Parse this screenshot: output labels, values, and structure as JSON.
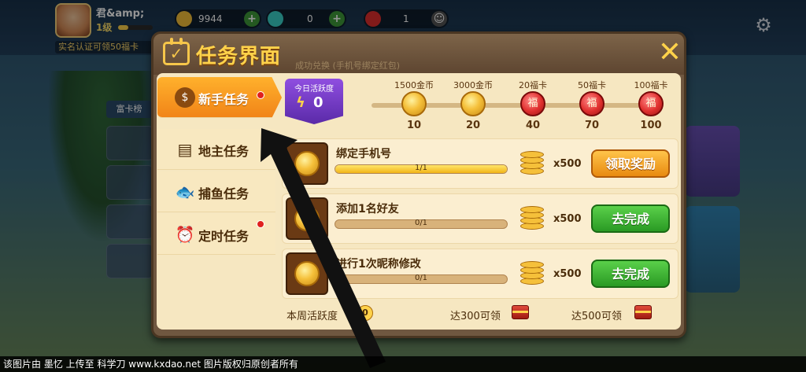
{
  "background": {
    "player_name": "君&amp;",
    "player_level": "1级",
    "realname_tip": "实名认证可领50福卡",
    "resources": [
      {
        "name": "gold-coin",
        "value": "9944",
        "color": "#f5c03a"
      },
      {
        "name": "diamond",
        "value": "0",
        "color": "#3ad0c8"
      },
      {
        "name": "lucky-card",
        "value": "1",
        "color": "#e0302e"
      }
    ],
    "rank_label": "富卡榜",
    "faded_header": "成功兑换 (手机号绑定红包)"
  },
  "modal": {
    "title": "任务界面",
    "close": "✕"
  },
  "tabs": [
    {
      "label": "新手任务",
      "icon": "money-bag-icon",
      "glyph": "$",
      "active": true,
      "dot": true
    },
    {
      "label": "地主任务",
      "icon": "calendar-icon",
      "glyph": "▤",
      "active": false,
      "dot": false
    },
    {
      "label": "捕鱼任务",
      "icon": "fish-icon",
      "glyph": "🐟",
      "active": false,
      "dot": false
    },
    {
      "label": "定时任务",
      "icon": "alarm-clock-icon",
      "glyph": "⏰",
      "active": false,
      "dot": true
    }
  ],
  "activity": {
    "label": "今日活跃度",
    "value": "0",
    "progress": 0,
    "milestones": [
      {
        "reward": "1500金币",
        "points": "10",
        "type": "coin"
      },
      {
        "reward": "3000金币",
        "points": "20",
        "type": "coin"
      },
      {
        "reward": "20福卡",
        "points": "40",
        "type": "card"
      },
      {
        "reward": "50福卡",
        "points": "70",
        "type": "card"
      },
      {
        "reward": "100福卡",
        "points": "100",
        "type": "card"
      }
    ]
  },
  "tasks": [
    {
      "name": "绑定手机号",
      "progress_text": "1/1",
      "progress": 1,
      "reward": "x500",
      "button": "领取奖励",
      "state": "claim"
    },
    {
      "name": "添加1名好友",
      "progress_text": "0/1",
      "progress": 0,
      "reward": "x500",
      "button": "去完成",
      "state": "go"
    },
    {
      "name": "进行1次昵称修改",
      "progress_text": "0/1",
      "progress": 0,
      "reward": "x500",
      "button": "去完成",
      "state": "go"
    }
  ],
  "footer": {
    "weekly_label": "本周活跃度",
    "weekly_value": "0",
    "chest1": "达300可领",
    "chest2": "达500可领"
  },
  "watermark": "该图片由 墨忆 上传至 科学刀 www.kxdao.net 图片版权归原创者所有"
}
